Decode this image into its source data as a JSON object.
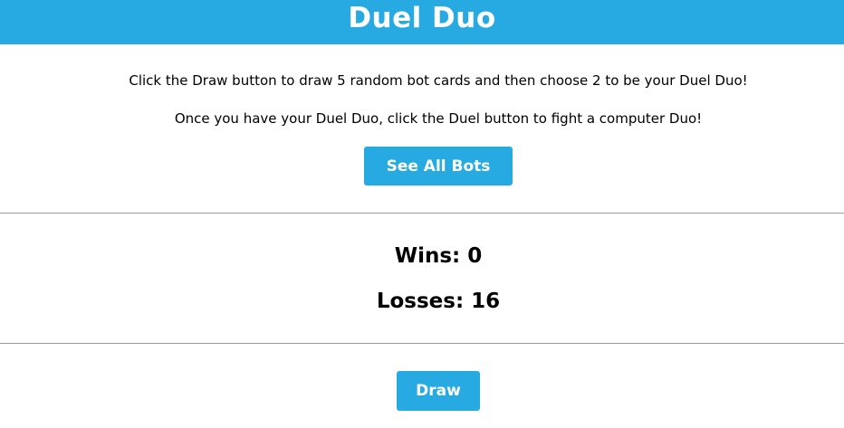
{
  "header": {
    "title": "Duel Duo"
  },
  "intro": {
    "line1": "Click the Draw button to draw 5 random bot cards and then choose 2 to be your Duel Duo!",
    "line2": "Once you have your Duel Duo, click the Duel button to fight a computer Duo!",
    "see_all_label": "See All Bots"
  },
  "score": {
    "wins": "Wins: 0",
    "losses": "Losses: 16"
  },
  "actions": {
    "draw_label": "Draw"
  },
  "colors": {
    "accent": "#27a9e1",
    "divider": "#9a9a9a"
  }
}
